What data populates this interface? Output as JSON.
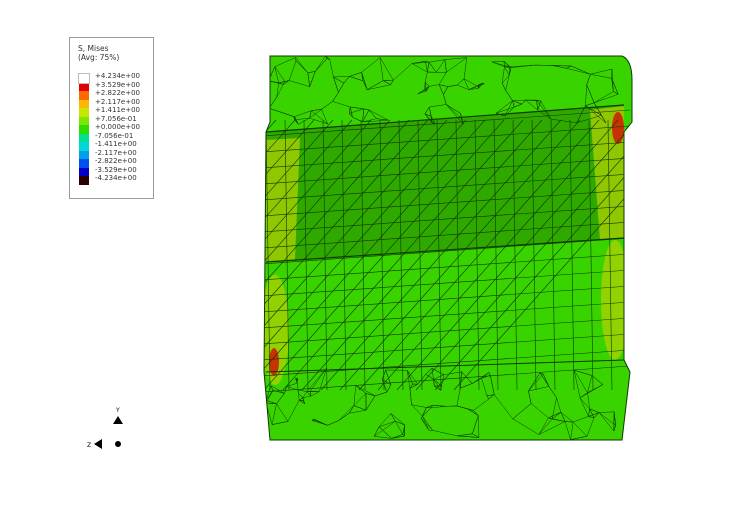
{
  "legend": {
    "title_line1": "S, Mises",
    "title_line2": "(Avg: 75%)",
    "entries": [
      {
        "label": "+4.234e+00",
        "color": "#ffffff"
      },
      {
        "label": "+3.529e+00",
        "color": "#e00000"
      },
      {
        "label": "+2.822e+00",
        "color": "#ff6a00"
      },
      {
        "label": "+2.117e+00",
        "color": "#ffb800"
      },
      {
        "label": "+1.411e+00",
        "color": "#c8e600"
      },
      {
        "label": "+7.056e-01",
        "color": "#7ee600"
      },
      {
        "label": "+0.000e+00",
        "color": "#2fdc00"
      },
      {
        "label": "-7.056e-01",
        "color": "#00e090"
      },
      {
        "label": "-1.411e+00",
        "color": "#00d8d8"
      },
      {
        "label": "-2.117e+00",
        "color": "#00a0e8"
      },
      {
        "label": "-2.822e+00",
        "color": "#0050f0"
      },
      {
        "label": "-3.529e+00",
        "color": "#0000c8"
      },
      {
        "label": "-4.234e+00",
        "color": "#2a0000"
      }
    ]
  },
  "triad": {
    "y_label": "Y",
    "z_label": "Z",
    "y_color": "#18b418",
    "z_color": "#1010d0",
    "x_color": "#b40000"
  },
  "model": {
    "base_color": "#39d400",
    "band_color": "#2fa800",
    "warm_color": "#b0d200",
    "hot_color": "#d01800",
    "mesh_color": "#0c3a00"
  }
}
